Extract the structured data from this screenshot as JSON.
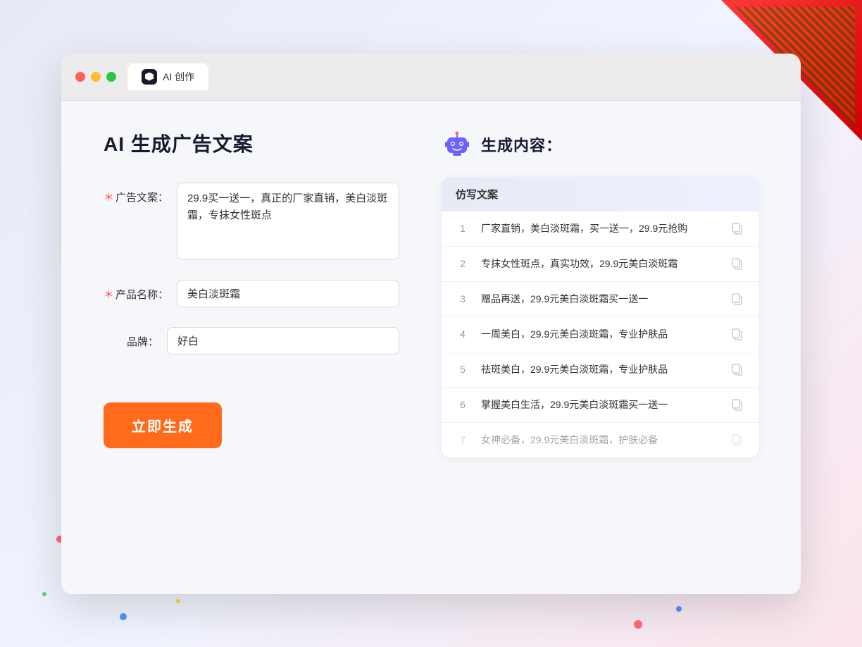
{
  "browser": {
    "tab_label": "AI 创作",
    "tab_icon_text": "AI"
  },
  "left_panel": {
    "title": "AI 生成广告文案",
    "form": {
      "ad_copy_label": "广告文案：",
      "ad_copy_required": "＊",
      "ad_copy_value": "29.9买一送一，真正的厂家直销，美白淡斑霜，专抹女性斑点",
      "product_name_label": "产品名称：",
      "product_name_required": "＊",
      "product_name_value": "美白淡斑霜",
      "brand_label": "品牌：",
      "brand_value": "好白"
    },
    "generate_button": "立即生成"
  },
  "right_panel": {
    "title": "生成内容：",
    "results_header": "仿写文案",
    "results": [
      {
        "num": "1",
        "text": "厂家直销，美白淡斑霜，买一送一，29.9元抢购",
        "faded": false
      },
      {
        "num": "2",
        "text": "专抹女性斑点，真实功效，29.9元美白淡斑霜",
        "faded": false
      },
      {
        "num": "3",
        "text": "赠品再送，29.9元美白淡斑霜买一送一",
        "faded": false
      },
      {
        "num": "4",
        "text": "一周美白，29.9元美白淡斑霜，专业护肤品",
        "faded": false
      },
      {
        "num": "5",
        "text": "祛斑美白，29.9元美白淡斑霜，专业护肤品",
        "faded": false
      },
      {
        "num": "6",
        "text": "掌握美白生活，29.9元美白淡斑霜买一送一",
        "faded": false
      },
      {
        "num": "7",
        "text": "女神必备，29.9元美白淡斑霜，护肤必备",
        "faded": true
      }
    ]
  }
}
